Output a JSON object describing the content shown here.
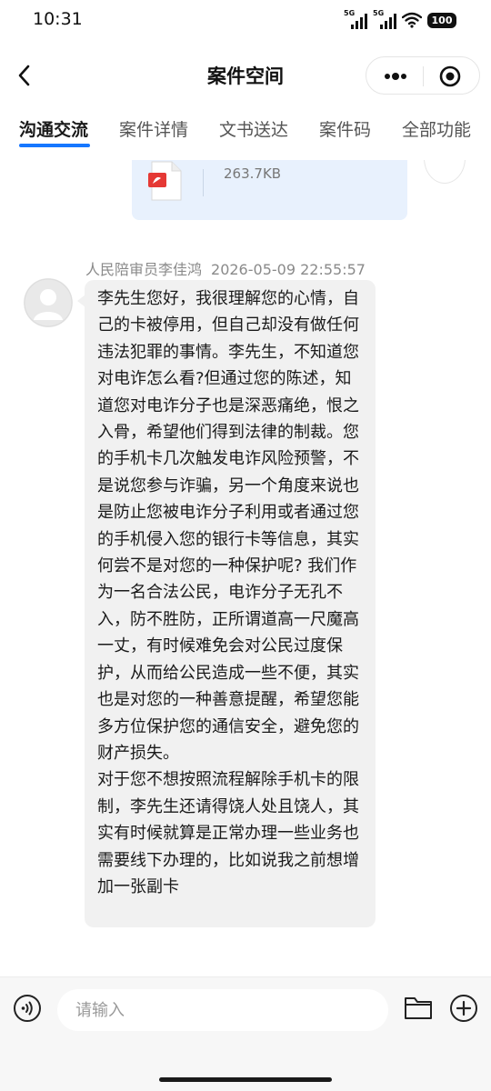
{
  "status_bar": {
    "time": "10:31",
    "signal_1_label": "5G",
    "signal_2_label": "5G",
    "battery": "100"
  },
  "header": {
    "title": "案件空间",
    "back_icon": "chevron-left-icon",
    "more_icon": "more-dots-icon",
    "close_icon": "target-close-icon"
  },
  "tabs": [
    {
      "label": "沟通交流",
      "active": true
    },
    {
      "label": "案件详情",
      "active": false
    },
    {
      "label": "文书送达",
      "active": false
    },
    {
      "label": "案件码",
      "active": false
    },
    {
      "label": "全部功能",
      "active": false
    }
  ],
  "chat": {
    "file_message": {
      "size": "263.7KB",
      "icon": "pdf-icon"
    },
    "message": {
      "sender": "人民陪审员李佳鸿",
      "timestamp": "2026-05-09 22:55:57",
      "paragraphs": [
        "李先生您好，我很理解您的心情，自己的卡被停用，但自己却没有做任何违法犯罪的事情。李先生，不知道您对电诈怎么看?但通过您的陈述，知道您对电诈分子也是深恶痛绝，恨之入骨，希望他们得到法律的制裁。您的手机卡几次触发电诈风险预警，不是说您参与诈骗，另一个角度来说也是防止您被电诈分子利用或者通过您的手机侵入您的银行卡等信息，其实何尝不是对您的一种保护呢? 我们作为一名合法公民，电诈分子无孔不入，防不胜防，正所谓道高一尺魔高一丈，有时候难免会对公民过度保护，从而给公民造成一些不便，其实也是对您的一种善意提醒，希望您能多方位保护您的通信安全，避免您的财产损失。",
        "对于您不想按照流程解除手机卡的限制，李先生还请得饶人处且饶人，其实有时候就算是正常办理一些业务也需要线下办理的，比如说我之前想增加一张副卡"
      ]
    }
  },
  "input_bar": {
    "placeholder": "请输入",
    "value": "",
    "voice_icon": "voice-icon",
    "folder_icon": "folder-icon",
    "plus_icon": "plus-circle-icon"
  }
}
